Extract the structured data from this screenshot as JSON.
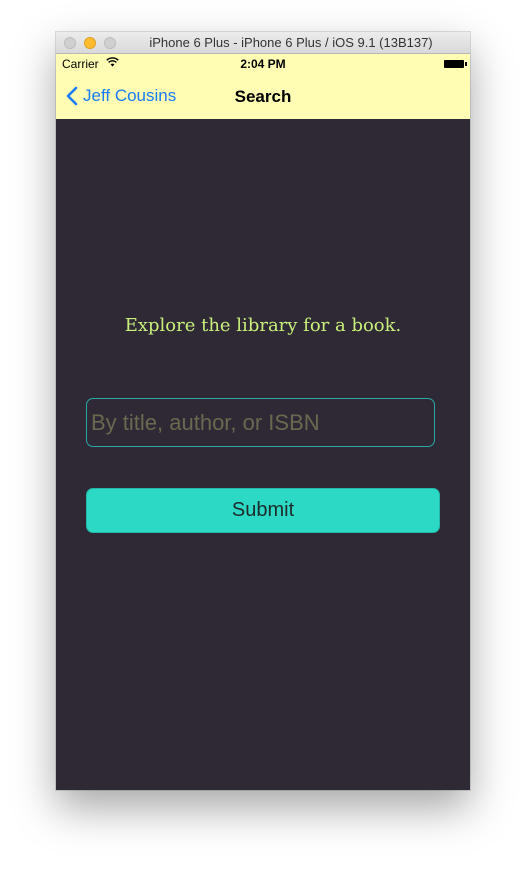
{
  "window": {
    "title": "iPhone 6 Plus - iPhone 6 Plus / iOS 9.1 (13B137)"
  },
  "status_bar": {
    "carrier": "Carrier",
    "time": "2:04 PM"
  },
  "nav": {
    "back_label": "Jeff Cousins",
    "title": "Search"
  },
  "main": {
    "prompt": "Explore the library for a book.",
    "search_placeholder": "By title, author, or ISBN",
    "search_value": "",
    "submit_label": "Submit"
  },
  "colors": {
    "nav_background": "#fffdb3",
    "content_background": "#2e2935",
    "accent_blue": "#1a7cf2",
    "prompt_text": "#c8f07a",
    "input_border": "#2aa7a8",
    "submit_background": "#2bd9c5"
  },
  "icons": {
    "back": "chevron-left-icon",
    "wifi": "wifi-icon",
    "battery": "battery-icon"
  }
}
